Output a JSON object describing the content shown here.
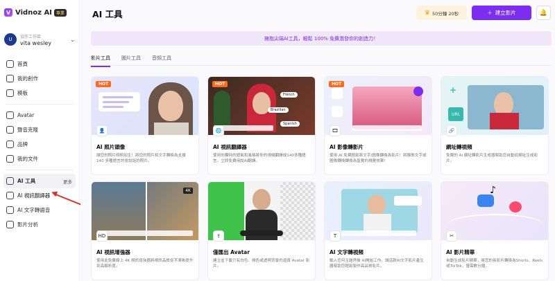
{
  "app": {
    "logo_text": "Vidnoz AI",
    "logo_badge": "專業",
    "workspace_label": "協作工作區",
    "workspace_name": "vita wesley",
    "workspace_avatar": "U"
  },
  "sidebar": {
    "items": [
      {
        "label": "首頁",
        "icon": "home-icon"
      },
      {
        "label": "我的創作",
        "icon": "folder-icon"
      },
      {
        "label": "模板",
        "icon": "template-icon"
      }
    ],
    "items2": [
      {
        "label": "Avatar",
        "icon": "avatar-icon"
      },
      {
        "label": "聲音克隆",
        "icon": "voice-icon"
      },
      {
        "label": "品牌",
        "icon": "brand-icon"
      },
      {
        "label": "我的文件",
        "icon": "file-icon"
      }
    ],
    "active": {
      "label": "AI 工具",
      "more": "更多"
    },
    "items3": [
      {
        "label": "AI 視訊翻譯器",
        "icon": "translate-icon"
      },
      {
        "label": "AI 文字轉語音",
        "icon": "tts-icon"
      },
      {
        "label": "影片分析",
        "icon": "analytics-icon"
      }
    ]
  },
  "header": {
    "title": "AI 工具",
    "credits": "50分鐘 20秒",
    "create_label": "建立影片"
  },
  "banner": "擁抱尖端AI工具，輕鬆 100% 免費激發你的創造力！",
  "tabs": [
    "影片工具",
    "圖片工具",
    "音頻工具"
  ],
  "cards": [
    {
      "title": "AI 照片頭像",
      "desc": "讓您的照片栩栩如生！將您的照片和文字轉換為支援 140 多種語言的會說話的照片。",
      "hot": "HOT"
    },
    {
      "title": "AI 視訊翻譯器",
      "desc": "使用你獨特的語氣和風格將你的視頻翻譯成140多種語言。立即免費用說AI翻譯。",
      "hot": "HOT",
      "langs": [
        "French",
        "Brazilian",
        "Spanish"
      ]
    },
    {
      "title": "AI 影像轉影片",
      "desc": "使用 AI 免費輕鬆將文字/圖像轉換為影片！將靜態文字或圖像轉換轉換為直覺的視覺效果！",
      "hot": "HOT"
    },
    {
      "title": "網址轉視頻",
      "desc": "免費的 AI 網址轉影片生成器幫助您自動從網址生成影片。",
      "badge": "URL"
    },
    {
      "title": "AI 視訊增強器",
      "desc": "使用此免費線上 4K 視訊增強器將視訊品質從不清晰提升到高解析度。",
      "badge": "4K"
    },
    {
      "title": "僅匯出 Avatar",
      "desc": "建立並下載只有白色、綠色或透明背景的逼真 Avatar 影片。"
    },
    {
      "title": "AI 文字轉視頻",
      "desc": "輸入任何主題然後 AI開始工作。讓這款AI文字影片產生器幫助您輕鬆製作高品質影片。"
    },
    {
      "title": "AI 影片精華",
      "desc": "自動生成影片精華，將您的長影片轉換為Shorts、Reels或TikTok，僅需數分鐘。"
    }
  ]
}
